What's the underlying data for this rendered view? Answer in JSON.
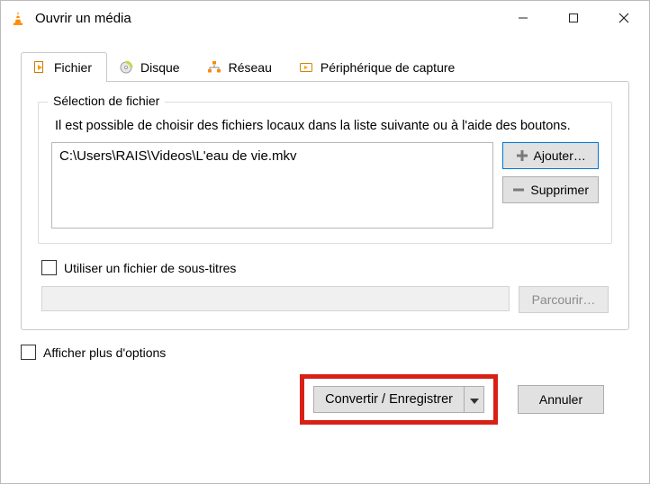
{
  "title": "Ouvrir un média",
  "tabs": {
    "file": "Fichier",
    "disc": "Disque",
    "network": "Réseau",
    "capture": "Périphérique de capture"
  },
  "file_group": {
    "legend": "Sélection de fichier",
    "hint": "Il est possible de choisir des fichiers locaux dans la liste suivante ou à l'aide des boutons.",
    "files": [
      "C:\\Users\\RAIS\\Videos\\L'eau de vie.mkv"
    ],
    "add": "Ajouter…",
    "remove": "Supprimer"
  },
  "subtitle": {
    "use_label": "Utiliser un fichier de sous-titres",
    "browse": "Parcourir…"
  },
  "more_options": "Afficher plus d'options",
  "footer": {
    "convert": "Convertir / Enregistrer",
    "cancel": "Annuler"
  }
}
